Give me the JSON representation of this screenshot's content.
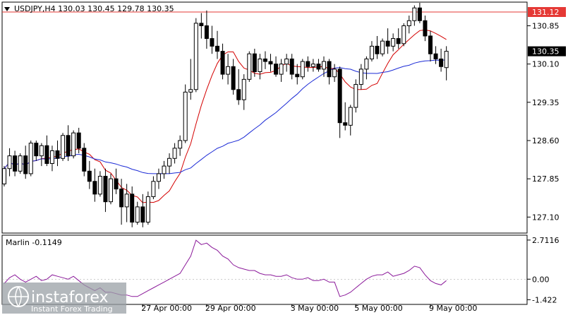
{
  "chart_data": {
    "type": "candlestick",
    "symbol_header": "USDJPY,H4  130.03 130.45 129.78 130.35",
    "price_axis": {
      "min": 126.8,
      "max": 131.3,
      "ticks": [
        "130.85",
        "130.10",
        "129.35",
        "128.60",
        "127.85",
        "127.10"
      ]
    },
    "resistance_level": {
      "value": 131.12,
      "label": "131.12",
      "color": "#e53935"
    },
    "current_price": {
      "value": 130.35,
      "label": "130.35"
    },
    "time_labels": [
      "27 Apr 00:00",
      "29 Apr 00:00",
      "3 May 00:00",
      "5 May 00:00",
      "9 May 00:00"
    ],
    "candles": [
      [
        127.75,
        128.1,
        127.7,
        128.05
      ],
      [
        128.05,
        128.45,
        127.9,
        128.3
      ],
      [
        128.3,
        128.4,
        127.9,
        128.0
      ],
      [
        128.0,
        128.35,
        127.95,
        128.3
      ],
      [
        128.3,
        128.5,
        127.85,
        127.95
      ],
      [
        127.95,
        128.6,
        127.9,
        128.55
      ],
      [
        128.55,
        128.6,
        128.2,
        128.3
      ],
      [
        128.3,
        128.55,
        128.1,
        128.5
      ],
      [
        128.5,
        128.7,
        128.1,
        128.15
      ],
      [
        128.15,
        128.5,
        128.0,
        128.4
      ],
      [
        128.4,
        128.6,
        128.1,
        128.25
      ],
      [
        128.25,
        128.75,
        128.2,
        128.7
      ],
      [
        128.7,
        128.9,
        128.2,
        128.3
      ],
      [
        128.3,
        128.8,
        128.25,
        128.75
      ],
      [
        128.75,
        128.85,
        128.35,
        128.45
      ],
      [
        128.45,
        128.55,
        127.9,
        128.0
      ],
      [
        128.0,
        128.2,
        127.65,
        127.8
      ],
      [
        127.8,
        128.05,
        127.4,
        127.55
      ],
      [
        127.55,
        128.0,
        127.5,
        127.9
      ],
      [
        127.9,
        128.05,
        127.2,
        127.4
      ],
      [
        127.4,
        127.95,
        127.35,
        127.85
      ],
      [
        127.85,
        128.05,
        127.55,
        127.65
      ],
      [
        127.65,
        127.85,
        126.95,
        127.3
      ],
      [
        127.3,
        127.75,
        127.0,
        127.55
      ],
      [
        127.55,
        127.7,
        126.9,
        127.0
      ],
      [
        127.0,
        127.4,
        126.95,
        127.3
      ],
      [
        127.3,
        127.55,
        126.9,
        127.0
      ],
      [
        127.0,
        127.6,
        126.95,
        127.5
      ],
      [
        127.5,
        127.9,
        127.45,
        127.8
      ],
      [
        127.8,
        128.05,
        127.65,
        127.95
      ],
      [
        127.95,
        128.2,
        127.85,
        128.1
      ],
      [
        128.1,
        128.35,
        127.95,
        128.25
      ],
      [
        128.25,
        128.55,
        128.15,
        128.45
      ],
      [
        128.45,
        128.7,
        128.3,
        128.6
      ],
      [
        128.6,
        129.7,
        128.55,
        129.55
      ],
      [
        129.55,
        130.2,
        129.4,
        129.6
      ],
      [
        129.6,
        131.0,
        129.55,
        130.9
      ],
      [
        130.9,
        131.1,
        130.6,
        130.85
      ],
      [
        130.85,
        131.15,
        130.4,
        130.6
      ],
      [
        130.6,
        130.85,
        130.3,
        130.45
      ],
      [
        130.45,
        130.75,
        130.2,
        130.35
      ],
      [
        130.35,
        130.5,
        129.8,
        129.9
      ],
      [
        129.9,
        130.3,
        129.7,
        130.05
      ],
      [
        130.05,
        130.2,
        129.5,
        129.6
      ],
      [
        129.6,
        130.0,
        129.3,
        129.4
      ],
      [
        129.4,
        129.9,
        129.2,
        129.8
      ],
      [
        129.8,
        130.35,
        129.75,
        130.3
      ],
      [
        130.3,
        130.4,
        129.85,
        129.95
      ],
      [
        129.95,
        130.3,
        129.8,
        130.2
      ],
      [
        130.2,
        130.35,
        130.0,
        130.15
      ],
      [
        130.15,
        130.3,
        129.95,
        130.1
      ],
      [
        130.1,
        130.25,
        129.85,
        129.9
      ],
      [
        129.9,
        130.2,
        129.75,
        130.1
      ],
      [
        130.1,
        130.3,
        129.95,
        130.2
      ],
      [
        130.2,
        130.3,
        129.8,
        129.9
      ],
      [
        129.9,
        130.1,
        129.7,
        129.85
      ],
      [
        129.85,
        130.2,
        129.8,
        130.15
      ],
      [
        130.15,
        130.25,
        129.95,
        130.05
      ],
      [
        130.05,
        130.2,
        129.95,
        130.1
      ],
      [
        130.1,
        130.2,
        129.95,
        130.0
      ],
      [
        130.0,
        130.25,
        129.85,
        130.15
      ],
      [
        130.15,
        130.2,
        129.7,
        129.85
      ],
      [
        129.85,
        130.1,
        129.75,
        130.0
      ],
      [
        130.0,
        130.05,
        128.65,
        128.95
      ],
      [
        128.95,
        129.35,
        128.8,
        128.9
      ],
      [
        128.9,
        129.3,
        128.7,
        129.25
      ],
      [
        129.25,
        129.8,
        129.15,
        129.7
      ],
      [
        129.7,
        130.1,
        129.6,
        130.0
      ],
      [
        130.0,
        130.25,
        129.8,
        130.2
      ],
      [
        130.2,
        130.55,
        130.15,
        130.45
      ],
      [
        130.45,
        130.65,
        130.2,
        130.3
      ],
      [
        130.3,
        130.6,
        130.25,
        130.55
      ],
      [
        130.55,
        130.8,
        130.3,
        130.45
      ],
      [
        130.45,
        130.7,
        130.35,
        130.6
      ],
      [
        130.6,
        130.8,
        130.4,
        130.5
      ],
      [
        130.5,
        130.9,
        130.45,
        130.85
      ],
      [
        130.85,
        131.05,
        130.7,
        130.95
      ],
      [
        130.95,
        131.25,
        130.85,
        131.2
      ],
      [
        131.2,
        131.3,
        130.9,
        130.95
      ],
      [
        130.95,
        131.05,
        130.55,
        130.65
      ],
      [
        130.65,
        130.75,
        130.15,
        130.3
      ],
      [
        130.3,
        130.45,
        130.1,
        130.2
      ],
      [
        130.2,
        130.4,
        129.95,
        130.05
      ],
      [
        130.03,
        130.45,
        129.78,
        130.35
      ]
    ],
    "ma_fast_color": "#d40000",
    "ma_slow_color": "#1c2bd6",
    "oscillator": {
      "name": "Marlin",
      "header": "Marlin -0.1149",
      "ticks": [
        "2.7116",
        "0.00",
        "-1.422"
      ],
      "min": -1.7,
      "max": 3.0,
      "color": "#8b1a9a",
      "values": [
        -0.3,
        0.1,
        0.3,
        0.0,
        -0.2,
        0.0,
        0.2,
        -0.1,
        0.0,
        0.3,
        0.2,
        0.1,
        0.0,
        0.2,
        -0.1,
        -0.4,
        -0.6,
        -0.8,
        -0.6,
        -0.9,
        -0.9,
        -1.0,
        -1.1,
        -1.1,
        -1.2,
        -1.2,
        -1.0,
        -0.8,
        -0.6,
        -0.4,
        -0.2,
        0.0,
        0.2,
        0.4,
        1.0,
        1.6,
        2.7,
        2.4,
        2.5,
        2.2,
        2.0,
        1.6,
        1.4,
        1.0,
        0.8,
        0.7,
        0.6,
        0.6,
        0.4,
        0.3,
        0.3,
        0.2,
        0.2,
        0.3,
        0.1,
        0.0,
        0.0,
        0.1,
        -0.1,
        -0.1,
        0.0,
        -0.2,
        -0.2,
        -1.2,
        -1.1,
        -0.9,
        -0.6,
        -0.3,
        0.0,
        0.2,
        0.3,
        0.3,
        0.5,
        0.2,
        0.3,
        0.4,
        0.6,
        0.9,
        0.8,
        0.3,
        -0.1,
        -0.3,
        -0.4,
        -0.1
      ]
    },
    "grid": false
  },
  "watermark": {
    "brand": "instaforex",
    "tagline": "Instant Forex Trading"
  },
  "colors": {
    "candle_up": "#ffffff",
    "candle_down": "#000000",
    "axis": "#000000",
    "oscillator_zero": "#999999"
  }
}
